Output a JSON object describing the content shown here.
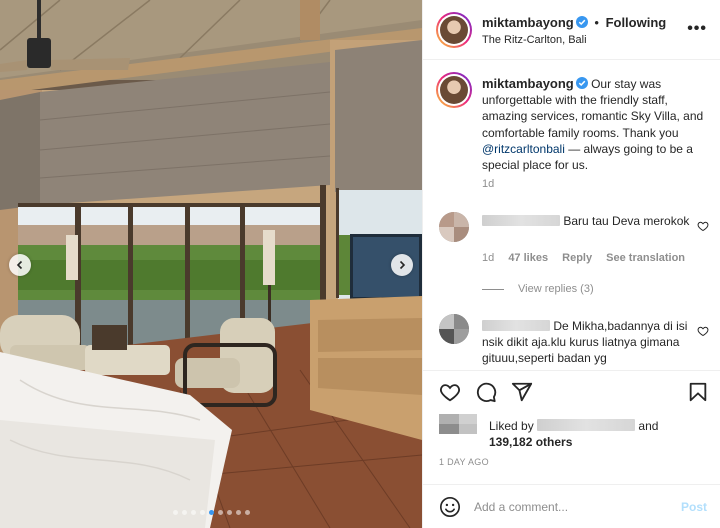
{
  "post": {
    "username": "miktambayong",
    "follow_label": "Following",
    "separator": "•",
    "location": "The Ritz-Carlton, Bali",
    "more_icon": "•••"
  },
  "caption": {
    "username": "miktambayong",
    "text_part1": "Our stay was unforgettable with the friendly staff, amazing services, romantic Sky Villa, and comfortable family rooms. Thank you ",
    "mention": "@ritzcarltonbali",
    "text_part2": " — always going to be a special place for us.",
    "time": "1d"
  },
  "comments": [
    {
      "text": "Baru tau Deva merokok",
      "time": "1d",
      "likes": "47 likes",
      "reply_label": "Reply",
      "translate_label": "See translation",
      "view_replies": "View replies (3)"
    },
    {
      "text": "De Mikha,badannya di isi nsik dikit aja.klu kurus liatnya gimana gituuu,seperti badan yg"
    }
  ],
  "likes": {
    "liked_by_label": "Liked by",
    "and_label": "and",
    "others": "139,182 others"
  },
  "time_ago": "1 DAY AGO",
  "add_comment": {
    "placeholder": "Add a comment...",
    "post_label": "Post"
  },
  "carousel": {
    "slide_count": 9,
    "active_index": 4
  },
  "colors": {
    "verified": "#3897f0",
    "mention": "#00376b",
    "post_button": "#b2dffc",
    "muted": "#8e8e8e"
  },
  "icons": [
    "chevron-left-icon",
    "chevron-right-icon",
    "verified-badge-icon",
    "more-icon",
    "heart-icon",
    "comment-icon",
    "share-icon",
    "bookmark-icon",
    "emoji-icon"
  ]
}
